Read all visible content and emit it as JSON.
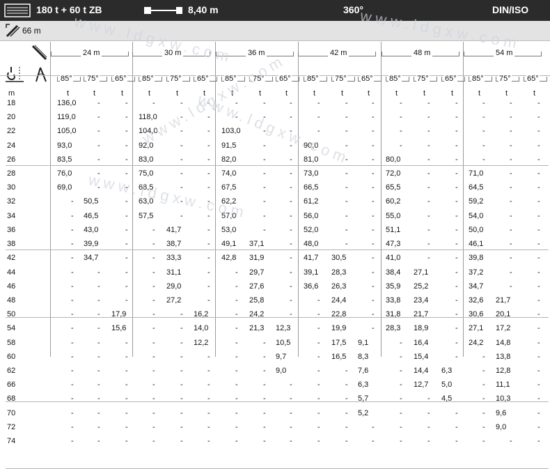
{
  "header": {
    "config": "180 t + 60 t ZB",
    "radius": "8,40 m",
    "slew": "360°",
    "standard": "DIN/ISO"
  },
  "sub": {
    "boom": "66 m"
  },
  "jibs": [
    "24 m",
    "30 m",
    "36 m",
    "42 m",
    "48 m",
    "54 m"
  ],
  "angles": [
    "85°",
    "75°",
    "65°"
  ],
  "units": {
    "radius": "m",
    "load": "t"
  },
  "rows": [
    [
      "18",
      "136,0",
      "-",
      "-",
      "-",
      "-",
      "-",
      "-",
      "-",
      "-",
      "-",
      "-",
      "-",
      "-",
      "-",
      "-",
      "-",
      "-",
      "-"
    ],
    [
      "20",
      "119,0",
      "-",
      "-",
      "118,0",
      "-",
      "-",
      "-",
      "-",
      "-",
      "-",
      "-",
      "-",
      "-",
      "-",
      "-",
      "-",
      "-",
      "-"
    ],
    [
      "22",
      "105,0",
      "-",
      "-",
      "104,0",
      "-",
      "-",
      "103,0",
      "-",
      "-",
      "-",
      "-",
      "-",
      "-",
      "-",
      "-",
      "-",
      "-",
      "-"
    ],
    [
      "24",
      "93,0",
      "-",
      "-",
      "92,0",
      "-",
      "-",
      "91,5",
      "-",
      "-",
      "90,0",
      "-",
      "-",
      "-",
      "-",
      "-",
      "-",
      "-",
      "-"
    ],
    [
      "26",
      "83,5",
      "-",
      "-",
      "83,0",
      "-",
      "-",
      "82,0",
      "-",
      "-",
      "81,0",
      "-",
      "-",
      "80,0",
      "-",
      "-",
      "-",
      "-",
      "-"
    ],
    [
      "28",
      "76,0",
      "-",
      "-",
      "75,0",
      "-",
      "-",
      "74,0",
      "-",
      "-",
      "73,0",
      "-",
      "-",
      "72,0",
      "-",
      "-",
      "71,0",
      "-",
      "-"
    ],
    [
      "30",
      "69,0",
      "-",
      "-",
      "68,5",
      "-",
      "-",
      "67,5",
      "-",
      "-",
      "66,5",
      "-",
      "-",
      "65,5",
      "-",
      "-",
      "64,5",
      "-",
      "-"
    ],
    [
      "32",
      "-",
      "50,5",
      "-",
      "63,0",
      "-",
      "-",
      "62,2",
      "-",
      "-",
      "61,2",
      "-",
      "-",
      "60,2",
      "-",
      "-",
      "59,2",
      "-",
      "-"
    ],
    [
      "34",
      "-",
      "46,5",
      "-",
      "57,5",
      "-",
      "-",
      "57,0",
      "-",
      "-",
      "56,0",
      "-",
      "-",
      "55,0",
      "-",
      "-",
      "54,0",
      "-",
      "-"
    ],
    [
      "36",
      "-",
      "43,0",
      "-",
      "-",
      "41,7",
      "-",
      "53,0",
      "-",
      "-",
      "52,0",
      "-",
      "-",
      "51,1",
      "-",
      "-",
      "50,0",
      "-",
      "-"
    ],
    [
      "38",
      "-",
      "39,9",
      "-",
      "-",
      "38,7",
      "-",
      "49,1",
      "37,1",
      "-",
      "48,0",
      "-",
      "-",
      "47,3",
      "-",
      "-",
      "46,1",
      "-",
      "-"
    ],
    [
      "42",
      "-",
      "34,7",
      "-",
      "-",
      "33,3",
      "-",
      "42,8",
      "31,9",
      "-",
      "41,7",
      "30,5",
      "-",
      "41,0",
      "-",
      "-",
      "39,8",
      "-",
      "-"
    ],
    [
      "44",
      "-",
      "-",
      "-",
      "-",
      "31,1",
      "-",
      "-",
      "29,7",
      "-",
      "39,1",
      "28,3",
      "-",
      "38,4",
      "27,1",
      "-",
      "37,2",
      "-",
      "-"
    ],
    [
      "46",
      "-",
      "-",
      "-",
      "-",
      "29,0",
      "-",
      "-",
      "27,6",
      "-",
      "36,6",
      "26,3",
      "-",
      "35,9",
      "25,2",
      "-",
      "34,7",
      "-",
      "-"
    ],
    [
      "48",
      "-",
      "-",
      "-",
      "-",
      "27,2",
      "-",
      "-",
      "25,8",
      "-",
      "-",
      "24,4",
      "-",
      "33,8",
      "23,4",
      "-",
      "32,6",
      "21,7",
      "-"
    ],
    [
      "50",
      "-",
      "-",
      "17,9",
      "-",
      "-",
      "16,2",
      "-",
      "24,2",
      "-",
      "-",
      "22,8",
      "-",
      "31,8",
      "21,7",
      "-",
      "30,6",
      "20,1",
      "-"
    ],
    [
      "54",
      "-",
      "-",
      "15,6",
      "-",
      "-",
      "14,0",
      "-",
      "21,3",
      "12,3",
      "-",
      "19,9",
      "-",
      "28,3",
      "18,9",
      "-",
      "27,1",
      "17,2",
      "-"
    ],
    [
      "58",
      "-",
      "-",
      "-",
      "-",
      "-",
      "12,2",
      "-",
      "-",
      "10,5",
      "-",
      "17,5",
      "9,1",
      "-",
      "16,4",
      "-",
      "24,2",
      "14,8",
      "-"
    ],
    [
      "60",
      "-",
      "-",
      "-",
      "-",
      "-",
      "-",
      "-",
      "-",
      "9,7",
      "-",
      "16,5",
      "8,3",
      "-",
      "15,4",
      "-",
      "-",
      "13,8",
      "-"
    ],
    [
      "62",
      "-",
      "-",
      "-",
      "-",
      "-",
      "-",
      "-",
      "-",
      "9,0",
      "-",
      "-",
      "7,6",
      "-",
      "14,4",
      "6,3",
      "-",
      "12,8",
      "-"
    ],
    [
      "66",
      "-",
      "-",
      "-",
      "-",
      "-",
      "-",
      "-",
      "-",
      "-",
      "-",
      "-",
      "6,3",
      "-",
      "12,7",
      "5,0",
      "-",
      "11,1",
      "-"
    ],
    [
      "68",
      "-",
      "-",
      "-",
      "-",
      "-",
      "-",
      "-",
      "-",
      "-",
      "-",
      "-",
      "5,7",
      "-",
      "-",
      "4,5",
      "-",
      "10,3",
      "-"
    ],
    [
      "70",
      "-",
      "-",
      "-",
      "-",
      "-",
      "-",
      "-",
      "-",
      "-",
      "-",
      "-",
      "5,2",
      "-",
      "-",
      "-",
      "-",
      "9,6",
      "-"
    ],
    [
      "72",
      "-",
      "-",
      "-",
      "-",
      "-",
      "-",
      "-",
      "-",
      "-",
      "-",
      "-",
      "-",
      "-",
      "-",
      "-",
      "-",
      "9,0",
      "-"
    ],
    [
      "74",
      "-",
      "-",
      "-",
      "-",
      "-",
      "-",
      "-",
      "-",
      "-",
      "-",
      "-",
      "-",
      "-",
      "-",
      "-",
      "-",
      "-",
      "-"
    ]
  ],
  "icons": [
    "boom-table-icon",
    "runner-length-icon",
    "boom-length-icon",
    "jib-icon",
    "hook-icon",
    "luffing-angle-icon"
  ],
  "watermark": "www.ldgxw.com"
}
